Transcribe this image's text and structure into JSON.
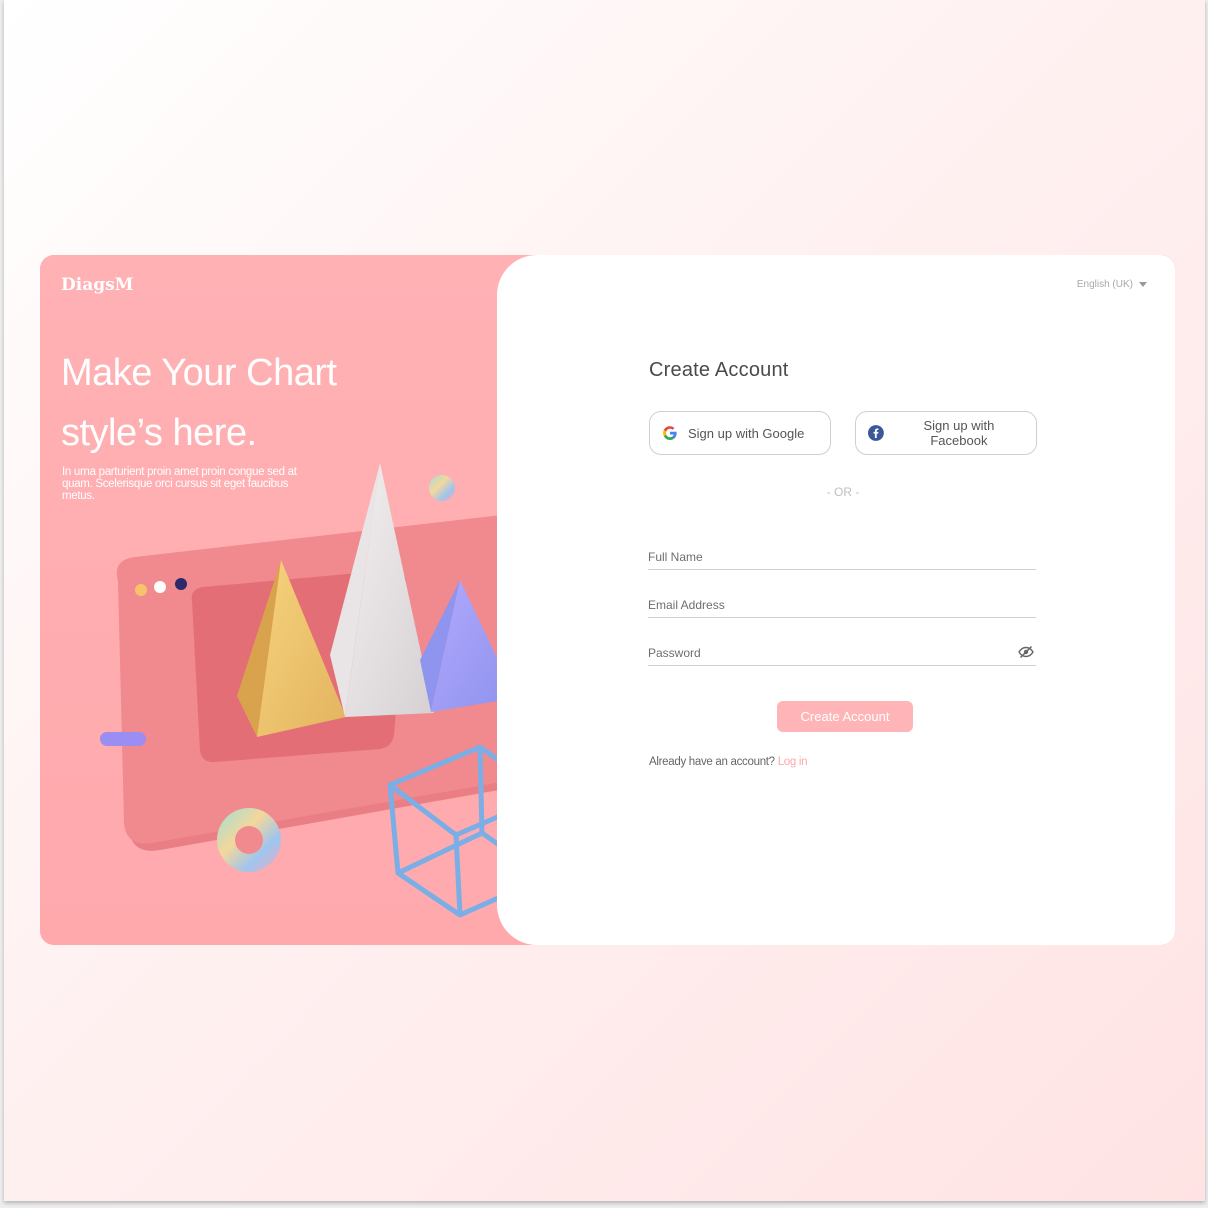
{
  "brand": {
    "logo": "DiagsM"
  },
  "hero": {
    "headline_line1": "Make Your Chart",
    "headline_line2": "style’s here.",
    "description": "In urna parturient proin amet proin congue sed at quam. Scelerisque orci cursus sit eget faucibus metus."
  },
  "language": {
    "selected": "English (UK)"
  },
  "form": {
    "title": "Create Account",
    "google_label": "Sign up with Google",
    "facebook_label": "Sign up with Facebook",
    "divider": "- OR -",
    "full_name_placeholder": "Full Name",
    "email_placeholder": "Email Address",
    "password_placeholder": "Password",
    "submit_label": "Create Account",
    "login_prompt": "Already have an account?",
    "login_link": "Log in"
  },
  "colors": {
    "accent_pink": "#ffb0b3",
    "link_pink": "#ffa8ac",
    "facebook_blue": "#3b5998"
  },
  "icons": [
    "google-icon",
    "facebook-icon",
    "eye-slash-icon",
    "chevron-down-icon"
  ]
}
